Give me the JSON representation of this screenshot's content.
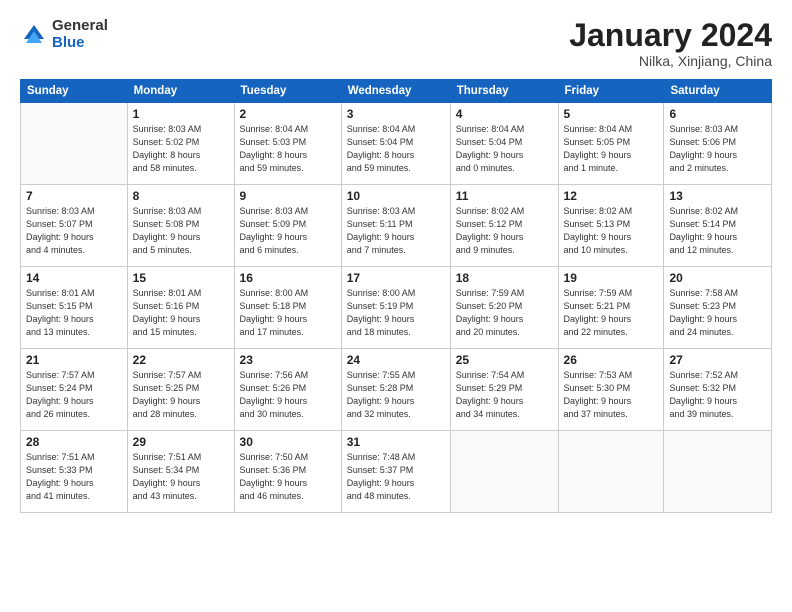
{
  "logo": {
    "general": "General",
    "blue": "Blue"
  },
  "header": {
    "title": "January 2024",
    "subtitle": "Nilka, Xinjiang, China"
  },
  "days_of_week": [
    "Sunday",
    "Monday",
    "Tuesday",
    "Wednesday",
    "Thursday",
    "Friday",
    "Saturday"
  ],
  "weeks": [
    [
      {
        "num": "",
        "info": ""
      },
      {
        "num": "1",
        "info": "Sunrise: 8:03 AM\nSunset: 5:02 PM\nDaylight: 8 hours\nand 58 minutes."
      },
      {
        "num": "2",
        "info": "Sunrise: 8:04 AM\nSunset: 5:03 PM\nDaylight: 8 hours\nand 59 minutes."
      },
      {
        "num": "3",
        "info": "Sunrise: 8:04 AM\nSunset: 5:04 PM\nDaylight: 8 hours\nand 59 minutes."
      },
      {
        "num": "4",
        "info": "Sunrise: 8:04 AM\nSunset: 5:04 PM\nDaylight: 9 hours\nand 0 minutes."
      },
      {
        "num": "5",
        "info": "Sunrise: 8:04 AM\nSunset: 5:05 PM\nDaylight: 9 hours\nand 1 minute."
      },
      {
        "num": "6",
        "info": "Sunrise: 8:03 AM\nSunset: 5:06 PM\nDaylight: 9 hours\nand 2 minutes."
      }
    ],
    [
      {
        "num": "7",
        "info": "Sunrise: 8:03 AM\nSunset: 5:07 PM\nDaylight: 9 hours\nand 4 minutes."
      },
      {
        "num": "8",
        "info": "Sunrise: 8:03 AM\nSunset: 5:08 PM\nDaylight: 9 hours\nand 5 minutes."
      },
      {
        "num": "9",
        "info": "Sunrise: 8:03 AM\nSunset: 5:09 PM\nDaylight: 9 hours\nand 6 minutes."
      },
      {
        "num": "10",
        "info": "Sunrise: 8:03 AM\nSunset: 5:11 PM\nDaylight: 9 hours\nand 7 minutes."
      },
      {
        "num": "11",
        "info": "Sunrise: 8:02 AM\nSunset: 5:12 PM\nDaylight: 9 hours\nand 9 minutes."
      },
      {
        "num": "12",
        "info": "Sunrise: 8:02 AM\nSunset: 5:13 PM\nDaylight: 9 hours\nand 10 minutes."
      },
      {
        "num": "13",
        "info": "Sunrise: 8:02 AM\nSunset: 5:14 PM\nDaylight: 9 hours\nand 12 minutes."
      }
    ],
    [
      {
        "num": "14",
        "info": "Sunrise: 8:01 AM\nSunset: 5:15 PM\nDaylight: 9 hours\nand 13 minutes."
      },
      {
        "num": "15",
        "info": "Sunrise: 8:01 AM\nSunset: 5:16 PM\nDaylight: 9 hours\nand 15 minutes."
      },
      {
        "num": "16",
        "info": "Sunrise: 8:00 AM\nSunset: 5:18 PM\nDaylight: 9 hours\nand 17 minutes."
      },
      {
        "num": "17",
        "info": "Sunrise: 8:00 AM\nSunset: 5:19 PM\nDaylight: 9 hours\nand 18 minutes."
      },
      {
        "num": "18",
        "info": "Sunrise: 7:59 AM\nSunset: 5:20 PM\nDaylight: 9 hours\nand 20 minutes."
      },
      {
        "num": "19",
        "info": "Sunrise: 7:59 AM\nSunset: 5:21 PM\nDaylight: 9 hours\nand 22 minutes."
      },
      {
        "num": "20",
        "info": "Sunrise: 7:58 AM\nSunset: 5:23 PM\nDaylight: 9 hours\nand 24 minutes."
      }
    ],
    [
      {
        "num": "21",
        "info": "Sunrise: 7:57 AM\nSunset: 5:24 PM\nDaylight: 9 hours\nand 26 minutes."
      },
      {
        "num": "22",
        "info": "Sunrise: 7:57 AM\nSunset: 5:25 PM\nDaylight: 9 hours\nand 28 minutes."
      },
      {
        "num": "23",
        "info": "Sunrise: 7:56 AM\nSunset: 5:26 PM\nDaylight: 9 hours\nand 30 minutes."
      },
      {
        "num": "24",
        "info": "Sunrise: 7:55 AM\nSunset: 5:28 PM\nDaylight: 9 hours\nand 32 minutes."
      },
      {
        "num": "25",
        "info": "Sunrise: 7:54 AM\nSunset: 5:29 PM\nDaylight: 9 hours\nand 34 minutes."
      },
      {
        "num": "26",
        "info": "Sunrise: 7:53 AM\nSunset: 5:30 PM\nDaylight: 9 hours\nand 37 minutes."
      },
      {
        "num": "27",
        "info": "Sunrise: 7:52 AM\nSunset: 5:32 PM\nDaylight: 9 hours\nand 39 minutes."
      }
    ],
    [
      {
        "num": "28",
        "info": "Sunrise: 7:51 AM\nSunset: 5:33 PM\nDaylight: 9 hours\nand 41 minutes."
      },
      {
        "num": "29",
        "info": "Sunrise: 7:51 AM\nSunset: 5:34 PM\nDaylight: 9 hours\nand 43 minutes."
      },
      {
        "num": "30",
        "info": "Sunrise: 7:50 AM\nSunset: 5:36 PM\nDaylight: 9 hours\nand 46 minutes."
      },
      {
        "num": "31",
        "info": "Sunrise: 7:48 AM\nSunset: 5:37 PM\nDaylight: 9 hours\nand 48 minutes."
      },
      {
        "num": "",
        "info": ""
      },
      {
        "num": "",
        "info": ""
      },
      {
        "num": "",
        "info": ""
      }
    ]
  ]
}
